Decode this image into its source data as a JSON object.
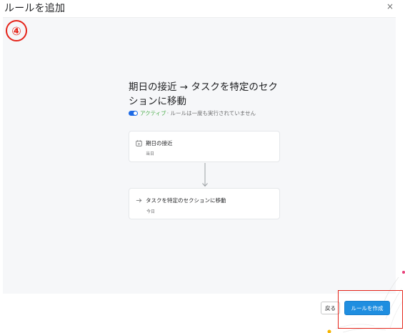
{
  "dialog": {
    "title": "ルールを追加",
    "close_symbol": "×"
  },
  "annotation": {
    "step_marker": "④"
  },
  "rule": {
    "title": "期日の接近 → タスクを特定のセクションに移動",
    "status_active": "アクティブ",
    "status_detail": "· ルールは一度も実行されていません"
  },
  "trigger": {
    "label": "期日の接近",
    "sub": "当日",
    "icon": "calendar-icon"
  },
  "action": {
    "label": "タスクを特定のセクションに移動",
    "sub": "今日",
    "icon": "arrow-right-icon"
  },
  "footer": {
    "back_label": "戻る",
    "create_label": "ルールを作成"
  },
  "colors": {
    "primary_button": "#1f8ee0",
    "toggle_on": "#1d6ae5",
    "active_text": "#4cae4c",
    "annotation_red": "#e5241a"
  }
}
